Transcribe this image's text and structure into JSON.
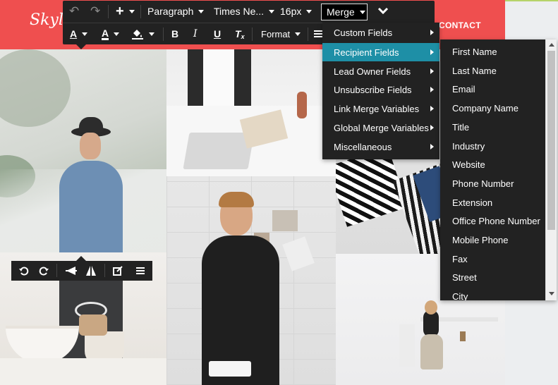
{
  "site": {
    "brand": "Skyl",
    "nav_contact": "CONTACT"
  },
  "toolbar": {
    "undo_icon": "undo-icon",
    "redo_icon": "redo-icon",
    "insert_icon": "plus-icon",
    "paragraph_label": "Paragraph",
    "font_family_label": "Times Ne...",
    "font_size_label": "16px",
    "merge_label": "Merge",
    "collapse_icon": "chevron-down-icon",
    "text_color_letter": "A",
    "highlight_letter": "A",
    "bold_letter": "B",
    "italic_letter": "I",
    "underline_letter": "U",
    "clear_format_letter": "T",
    "format_label": "Format",
    "colors": {
      "background": "#222222",
      "merge_button_border": "#dddddd",
      "menu_highlight": "#1e8fa6"
    }
  },
  "merge_menu": {
    "items": [
      {
        "label": "Custom Fields"
      },
      {
        "label": "Recipient Fields"
      },
      {
        "label": "Lead Owner Fields"
      },
      {
        "label": "Unsubscribe Fields"
      },
      {
        "label": "Link Merge Variables"
      },
      {
        "label": "Global Merge Variables"
      },
      {
        "label": "Miscellaneous"
      }
    ],
    "active": "Recipient Fields"
  },
  "recipient_fields": {
    "items": [
      "First Name",
      "Last Name",
      "Email",
      "Company Name",
      "Title",
      "Industry",
      "Website",
      "Phone Number",
      "Extension",
      "Office Phone Number",
      "Mobile Phone",
      "Fax",
      "Street",
      "City"
    ]
  },
  "image_toolbar": {
    "icons": [
      "rotate-left-icon",
      "rotate-right-icon",
      "flip-horizontal-icon",
      "flip-vertical-icon",
      "edit-icon",
      "menu-icon"
    ]
  },
  "colors": {
    "header_red": "#ef4f4f",
    "menu_background": "#222222"
  }
}
